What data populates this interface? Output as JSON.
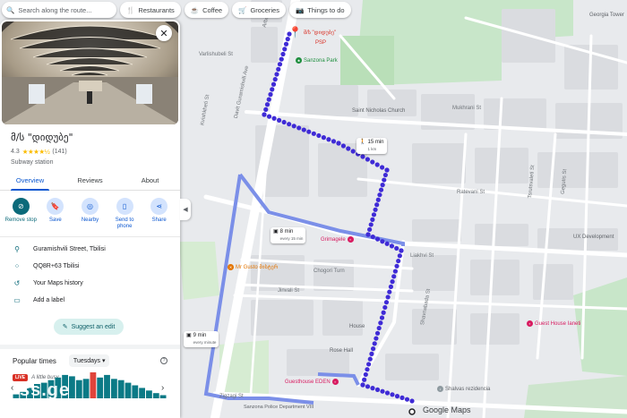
{
  "search": {
    "placeholder": "Search along the route...",
    "chips": [
      {
        "icon": "fork-knife-icon",
        "label": "Restaurants"
      },
      {
        "icon": "coffee-icon",
        "label": "Coffee"
      },
      {
        "icon": "cart-icon",
        "label": "Groceries"
      },
      {
        "icon": "camera-icon",
        "label": "Things to do"
      }
    ]
  },
  "place": {
    "name": "მ/ს \"დიდუბე\"",
    "rating": "4.3",
    "stars": "★★★★½",
    "reviews": "(141)",
    "category": "Subway station"
  },
  "tabs": [
    "Overview",
    "Reviews",
    "About"
  ],
  "actions": [
    {
      "icon": "remove-stop-icon",
      "label": "Remove stop"
    },
    {
      "icon": "bookmark-icon",
      "label": "Save"
    },
    {
      "icon": "nearby-icon",
      "label": "Nearby"
    },
    {
      "icon": "send-phone-icon",
      "label": "Send to phone"
    },
    {
      "icon": "share-icon",
      "label": "Share"
    }
  ],
  "info": [
    {
      "icon": "location-pin-icon",
      "text": "Guramishvili Street, Tbilisi"
    },
    {
      "icon": "plus-code-icon",
      "text": "QQ8R+63 Tbilisi"
    },
    {
      "icon": "history-icon",
      "text": "Your Maps history"
    },
    {
      "icon": "label-icon",
      "text": "Add a label"
    }
  ],
  "suggest_edit": "Suggest an edit",
  "popular": {
    "title": "Popular times",
    "day": "Tuesdays",
    "live_badge": "LIVE",
    "live_text": "A little busy",
    "bars": [
      0.15,
      0.25,
      0.4,
      0.55,
      0.6,
      0.7,
      0.8,
      0.9,
      0.85,
      0.7,
      0.75,
      1.0,
      0.8,
      0.9,
      0.75,
      0.7,
      0.6,
      0.5,
      0.4,
      0.3,
      0.2,
      0.12
    ],
    "live_index": 11
  },
  "watermark": "ss.ge",
  "map": {
    "streets": [
      {
        "text": "Arbo St"
      },
      {
        "text": "Varlishubeli St"
      },
      {
        "text": "Kvishkheti St"
      },
      {
        "text": "Davit Guramishvili Ave"
      },
      {
        "text": "Saint Nicholas Church"
      },
      {
        "text": "Mukhrani St"
      },
      {
        "text": "Ratevani St"
      },
      {
        "text": "Liakhvi St"
      },
      {
        "text": "Chogori Turn"
      },
      {
        "text": "Jinvali St"
      },
      {
        "text": "Shavnabada St"
      },
      {
        "text": "Zigzagi St"
      },
      {
        "text": "Tsrutsvaleti St"
      },
      {
        "text": "Gegutis St"
      }
    ],
    "pois": [
      {
        "text": "მ/ს \"დიდუბე\"",
        "color": "#d93025"
      },
      {
        "text": "PSP",
        "color": "#d93025"
      },
      {
        "text": "Sanzona Park",
        "color": "#1e8e3e"
      },
      {
        "text": "Grimagele",
        "color": "#d81b60"
      },
      {
        "text": "Mr Gusto მისტერ",
        "color": "#e37400"
      },
      {
        "text": "Guesthouse EDEN",
        "color": "#d81b60"
      },
      {
        "text": "Guest House Ianeti",
        "color": "#d81b60"
      },
      {
        "text": "Shalvas rezidencia",
        "color": "#5f6368"
      },
      {
        "text": "Rose Hall",
        "color": "#5f6368"
      },
      {
        "text": "House",
        "color": "#5f6368"
      },
      {
        "text": "Sanzona Police Department VIII",
        "color": "#5f6368"
      },
      {
        "text": "UX Development",
        "color": "#5f6368"
      },
      {
        "text": "Georgia Tower",
        "color": "#5f6368"
      }
    ],
    "transit_cards": [
      {
        "time": "15 min",
        "sub": "1 km"
      },
      {
        "time": "8 min",
        "sub": "every 15 min"
      },
      {
        "time": "9 min",
        "sub": "every minute"
      }
    ],
    "logo": "Google Maps"
  }
}
